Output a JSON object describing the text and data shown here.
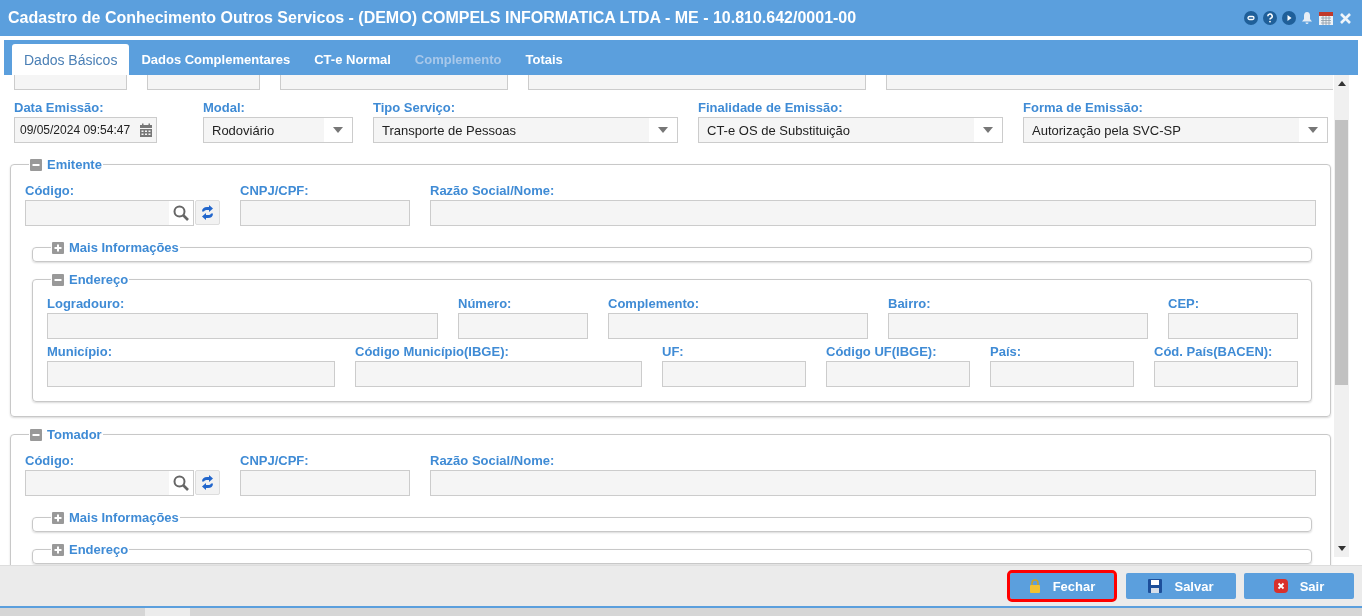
{
  "window": {
    "title": "Cadastro de Conhecimento Outros Servicos - (DEMO) COMPELS INFORMATICA LTDA - ME - 10.810.642/0001-00"
  },
  "tabs": [
    {
      "label": "Dados Básicos",
      "selected": true,
      "disabled": false
    },
    {
      "label": "Dados Complementares",
      "selected": false,
      "disabled": false
    },
    {
      "label": "CT-e Normal",
      "selected": false,
      "disabled": false
    },
    {
      "label": "Complemento",
      "selected": false,
      "disabled": true
    },
    {
      "label": "Totais",
      "selected": false,
      "disabled": false
    }
  ],
  "top_fields": [
    {
      "label": "Data Emissão:",
      "value": "09/05/2024 09:54:47",
      "kind": "date"
    },
    {
      "label": "Modal:",
      "value": "Rodoviário",
      "kind": "select"
    },
    {
      "label": "Tipo Serviço:",
      "value": "Transporte de Pessoas",
      "kind": "select"
    },
    {
      "label": "Finalidade de Emissão:",
      "value": "CT-e OS de Substituição",
      "kind": "select"
    },
    {
      "label": "Forma de Emissão:",
      "value": "Autorização pela SVC-SP",
      "kind": "select"
    }
  ],
  "sections": [
    {
      "title": "Emitente",
      "expanded": true,
      "field_lines": [
        {
          "fields": [
            {
              "label": "Código:",
              "kind": "lookup"
            },
            {
              "label": "CNPJ/CPF:",
              "kind": "text"
            },
            {
              "label": "Razão Social/Nome:",
              "kind": "text"
            }
          ]
        }
      ],
      "subsections": [
        {
          "title": "Mais Informações",
          "expanded": false
        },
        {
          "title": "Endereço",
          "expanded": true,
          "field_lines": [
            {
              "fields": [
                {
                  "label": "Logradouro:",
                  "kind": "text"
                },
                {
                  "label": "Número:",
                  "kind": "text"
                },
                {
                  "label": "Complemento:",
                  "kind": "text"
                },
                {
                  "label": "Bairro:",
                  "kind": "text"
                },
                {
                  "label": "CEP:",
                  "kind": "text"
                }
              ]
            },
            {
              "fields": [
                {
                  "label": "Município:",
                  "kind": "text"
                },
                {
                  "label": "Código Município(IBGE):",
                  "kind": "text"
                },
                {
                  "label": "UF:",
                  "kind": "text"
                },
                {
                  "label": "Código UF(IBGE):",
                  "kind": "text"
                },
                {
                  "label": "País:",
                  "kind": "text"
                },
                {
                  "label": "Cód. País(BACEN):",
                  "kind": "text"
                }
              ]
            }
          ]
        }
      ]
    },
    {
      "title": "Tomador",
      "expanded": true,
      "field_lines": [
        {
          "fields": [
            {
              "label": "Código:",
              "kind": "lookup"
            },
            {
              "label": "CNPJ/CPF:",
              "kind": "text"
            },
            {
              "label": "Razão Social/Nome:",
              "kind": "text"
            }
          ]
        }
      ],
      "subsections": [
        {
          "title": "Mais Informações",
          "expanded": false
        },
        {
          "title": "Endereço",
          "expanded": false
        }
      ]
    }
  ],
  "buttons": [
    {
      "label": "Fechar",
      "kind": "lock",
      "highlighted": true
    },
    {
      "label": "Salvar",
      "kind": "save",
      "highlighted": false
    },
    {
      "label": "Sair",
      "kind": "exit",
      "highlighted": false
    }
  ]
}
